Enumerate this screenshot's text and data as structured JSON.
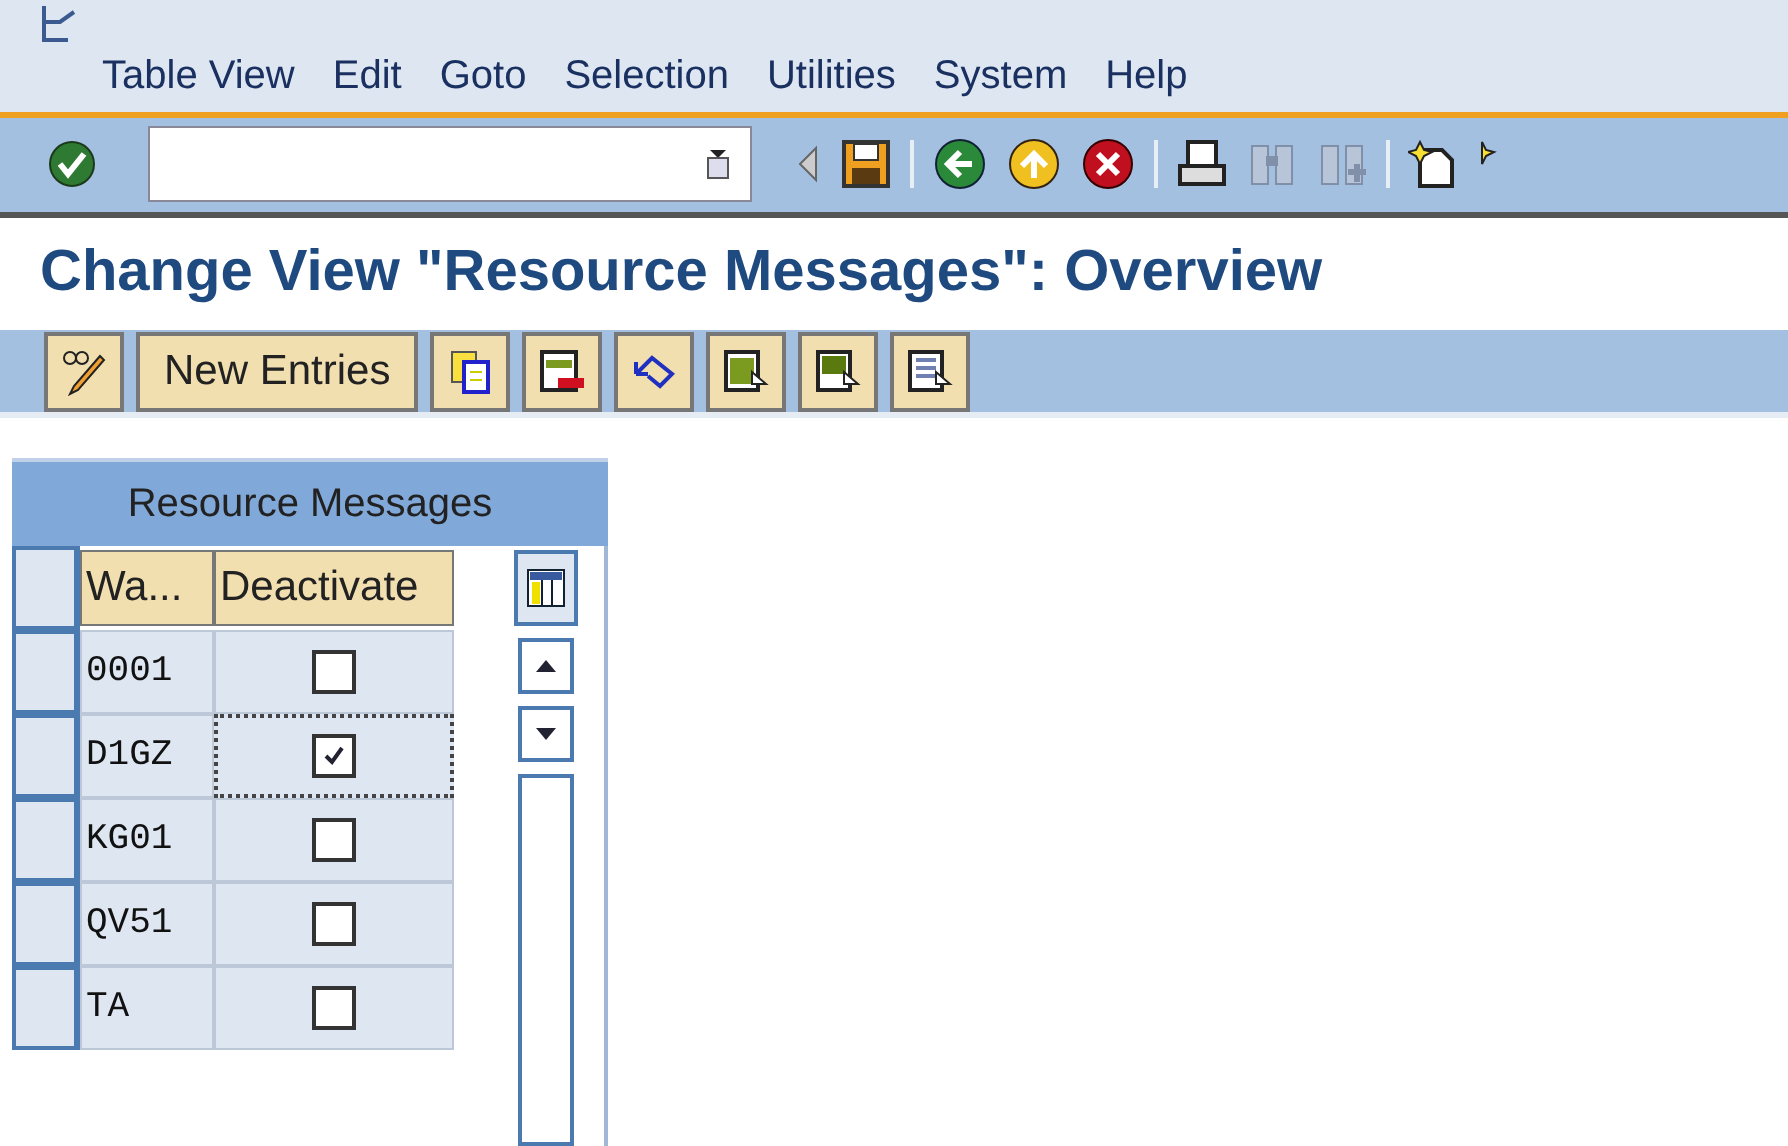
{
  "menu": [
    "Table View",
    "Edit",
    "Goto",
    "Selection",
    "Utilities",
    "System",
    "Help"
  ],
  "title": "Change View \"Resource Messages\": Overview",
  "app_toolbar": {
    "button_label": "New Entries"
  },
  "table": {
    "title": "Resource Messages",
    "columns": [
      "Wa...",
      "Deactivate"
    ],
    "rows": [
      {
        "code": "0001",
        "deactivate": false,
        "focused": false
      },
      {
        "code": "D1GZ",
        "deactivate": true,
        "focused": true
      },
      {
        "code": "KG01",
        "deactivate": false,
        "focused": false
      },
      {
        "code": "QV51",
        "deactivate": false,
        "focused": false
      },
      {
        "code": "TA",
        "deactivate": false,
        "focused": false
      }
    ]
  }
}
